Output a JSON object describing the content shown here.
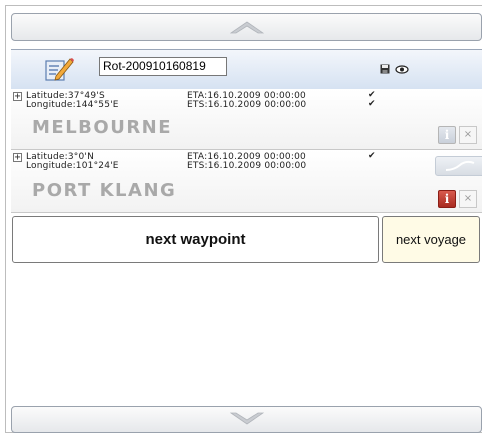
{
  "route": {
    "name": "Rot-200910160819"
  },
  "icons": {
    "edit": "edit-note-icon",
    "save": "save-icon",
    "view": "eye-icon",
    "up": "chevron-up-icon",
    "down": "chevron-down-icon"
  },
  "waypoints": [
    {
      "expander": "+",
      "latitude": "Latitude:37°49'S",
      "longitude": "Longitude:144°55'E",
      "eta": "ETA:16.10.2009 00:00:00",
      "ets": "ETS:16.10.2009 00:00:00",
      "eta_check": "✔",
      "ets_check": "✔",
      "city": "MELBOURNE",
      "info": "i",
      "close": "×",
      "info_active": false
    },
    {
      "expander": "+",
      "latitude": "Latitude:3°0'N",
      "longitude": "Longitude:101°24'E",
      "eta": "ETA:16.10.2009 00:00:00",
      "ets": "ETS:16.10.2009 00:00:00",
      "eta_check": "✔",
      "city": "PORT KLANG",
      "info": "i",
      "close": "×",
      "info_active": true
    }
  ],
  "actions": {
    "next_waypoint": "next waypoint",
    "next_voyage": "next voyage"
  },
  "colors": {
    "header_top": "#f3f6fb",
    "header_bottom": "#d6e2f2",
    "city": "#a9a9a9",
    "info_active": "#b8342a",
    "next_voyage_bg": "#fffbe6"
  }
}
